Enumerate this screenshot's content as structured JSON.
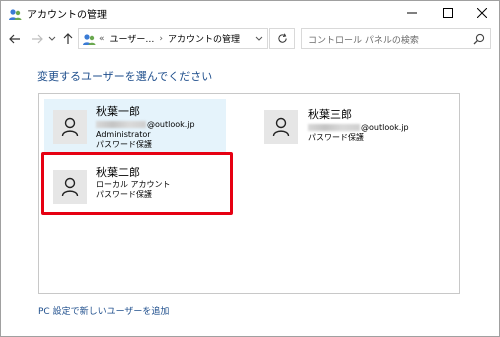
{
  "window": {
    "title": "アカウントの管理",
    "controls": {
      "minimize": "minimize",
      "maximize": "maximize",
      "close": "close"
    }
  },
  "nav": {
    "breadcrumb": [
      "«",
      "ユーザー…",
      "›",
      "アカウントの管理"
    ],
    "search_placeholder": "コントロール パネルの検索"
  },
  "main": {
    "heading": "変更するユーザーを選んでください",
    "add_user_link": "PC 設定で新しいユーザーを追加"
  },
  "accounts": [
    {
      "name": "秋葉一郎",
      "email_suffix": "@outlook.jp",
      "lines": [
        "Administrator",
        "パスワード保護"
      ],
      "selected": true
    },
    {
      "name": "秋葉二郎",
      "lines": [
        "ローカル アカウント",
        "パスワード保護"
      ],
      "highlighted": true
    },
    {
      "name": "秋葉三郎",
      "email_suffix": "@outlook.jp",
      "lines": [
        "パスワード保護"
      ]
    }
  ],
  "colors": {
    "accent_link": "#1e4e8c",
    "selected_bg": "#e5f3fb",
    "highlight_border": "#e60012"
  }
}
